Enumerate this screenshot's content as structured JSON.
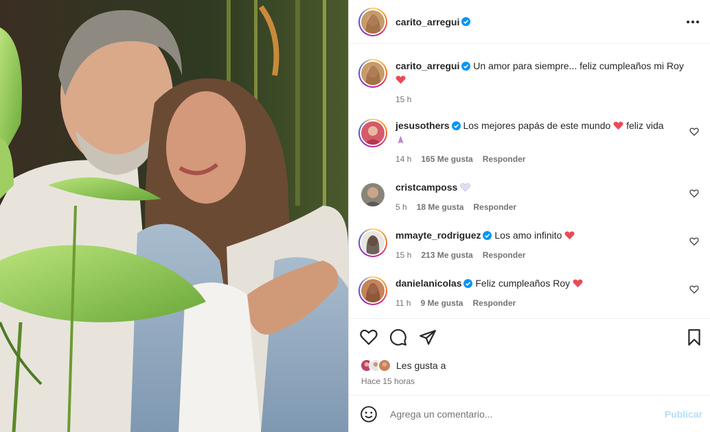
{
  "post": {
    "author": "carito_arregui",
    "caption": "Un amor para siempre... feliz cumpleaños mi Roy",
    "caption_time": "15 h"
  },
  "comments": [
    {
      "user": "jesusothers",
      "verified": true,
      "text": "Los mejores papás de este mundo",
      "text_after": "feliz vida",
      "time": "14 h",
      "likes": "165 Me gusta",
      "reply": "Responder"
    },
    {
      "user": "cristcamposs",
      "verified": false,
      "text": "",
      "time": "5 h",
      "likes": "18 Me gusta",
      "reply": "Responder"
    },
    {
      "user": "mmayte_rodriguez",
      "verified": true,
      "text": "Los amo infinito",
      "time": "15 h",
      "likes": "213 Me gusta",
      "reply": "Responder"
    },
    {
      "user": "danielanicolas",
      "verified": true,
      "text": "Feliz cumpleaños Roy",
      "time": "11 h",
      "likes": "9 Me gusta",
      "reply": "Responder"
    }
  ],
  "likes": {
    "text": "Les gusta a",
    "time_ago": "Hace 15 horas"
  },
  "add_comment": {
    "placeholder": "Agrega un comentario...",
    "publish": "Publicar"
  },
  "icons": {
    "actions": [
      "heart-icon",
      "comment-icon",
      "share-icon",
      "bookmark-icon"
    ],
    "more": "more-options-icon",
    "emoji": "smiley-icon"
  },
  "colors": {
    "verified": "#0095f6",
    "heart_emoji": "#ed4956",
    "publish_disabled": "#b2dffc",
    "secondary_text": "#737373"
  }
}
